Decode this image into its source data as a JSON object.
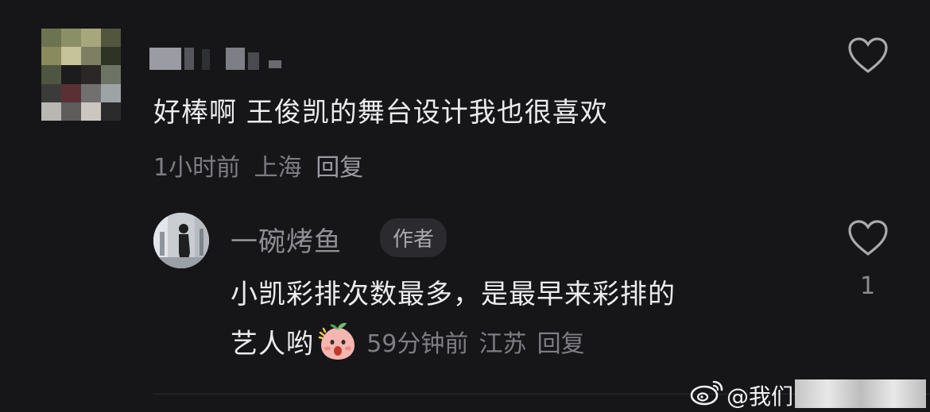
{
  "comment": {
    "text": "好棒啊 王俊凯的舞台设计我也很喜欢",
    "time": "1小时前",
    "location": "上海",
    "reply_label": "回复",
    "icons": {
      "avatar": "pixelated-avatar",
      "like": "heart-icon"
    }
  },
  "reply": {
    "user_name": "一碗烤鱼",
    "badge": "作者",
    "text_line1": "小凯彩排次数最多，是最早来彩排的",
    "text_line2": "艺人哟",
    "time": "59分钟前",
    "location": "江苏",
    "reply_label": "回复",
    "like_count": "1",
    "icons": {
      "avatar": "photo-avatar",
      "sticker": "surprised-peach-sticker",
      "like": "heart-icon"
    }
  },
  "watermark": {
    "text": "@我们",
    "icon": "weibo-logo-icon"
  },
  "colors": {
    "background": "#161619",
    "text": "#ececee",
    "muted": "#7d7d83",
    "badge_bg": "#2a2a2f"
  }
}
